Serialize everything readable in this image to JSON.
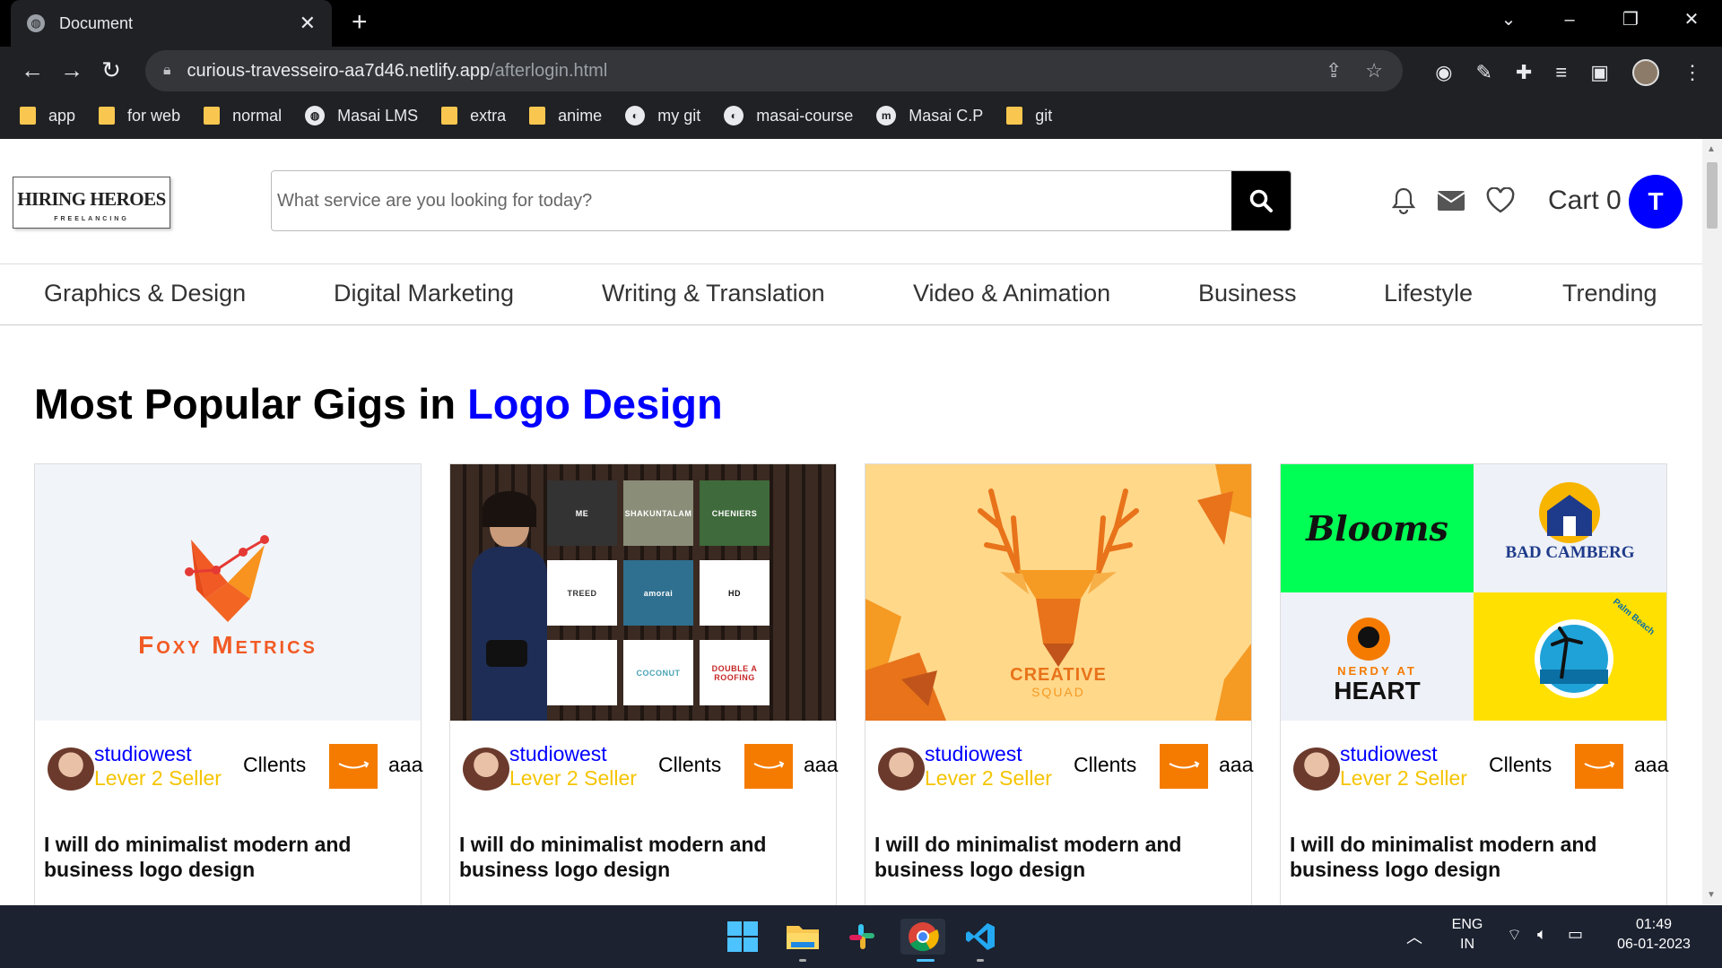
{
  "browser": {
    "tab_title": "Document",
    "url_host": "curious-travesseiro-aa7d46.netlify.app",
    "url_path": "/afterlogin.html",
    "bookmarks": [
      {
        "label": "app",
        "icon": "folder-icon"
      },
      {
        "label": "for web",
        "icon": "folder-icon"
      },
      {
        "label": "normal",
        "icon": "folder-icon"
      },
      {
        "label": "Masai LMS",
        "icon": "globe-icon"
      },
      {
        "label": "extra",
        "icon": "folder-icon"
      },
      {
        "label": "anime",
        "icon": "folder-icon"
      },
      {
        "label": "my git",
        "icon": "github-icon"
      },
      {
        "label": "masai-course",
        "icon": "github-icon"
      },
      {
        "label": "Masai C.P",
        "icon": "masai-icon"
      },
      {
        "label": "git",
        "icon": "folder-icon"
      }
    ]
  },
  "header": {
    "logo_title": "HIRING HEROES",
    "logo_subtitle": "FREELANCING",
    "search_placeholder": "What service are you looking for today?",
    "cart_label": "Cart 0",
    "avatar_letter": "T"
  },
  "categories": [
    "Graphics & Design",
    "Digital Marketing",
    "Writing & Translation",
    "Video & Animation",
    "Business",
    "Lifestyle",
    "Trending"
  ],
  "section": {
    "title_prefix": "Most Popular Gigs in ",
    "title_highlight": "Logo Design"
  },
  "cards": [
    {
      "seller": "studiowest",
      "level": "Lever 2 Seller",
      "clients": "Cllents",
      "client_name": "aaa",
      "title": "I will do minimalist modern and business logo design",
      "image": {
        "brand": "Foxy Metrics"
      }
    },
    {
      "seller": "studiowest",
      "level": "Lever 2 Seller",
      "clients": "Cllents",
      "client_name": "aaa",
      "title": "I will do minimalist modern and business logo design",
      "image": {
        "tiles": [
          "ME",
          "SHAKUNTALAM",
          "CHENIERS",
          "TREED",
          "amorai",
          "HD",
          "",
          "COCONUT",
          "DOUBLE A ROOFING"
        ]
      }
    },
    {
      "seller": "studiowest",
      "level": "Lever 2 Seller",
      "clients": "Cllents",
      "client_name": "aaa",
      "title": "I will do minimalist modern and business logo design",
      "image": {
        "line1": "CREATIVE",
        "line2": "SQUAD"
      }
    },
    {
      "seller": "studiowest",
      "level": "Lever 2 Seller",
      "clients": "Cllents",
      "client_name": "aaa",
      "title": "I will do minimalist modern and business logo design",
      "image": {
        "q1": "Blooms",
        "q2": "BAD CAMBERG",
        "q3a": "NERDY AT",
        "q3b": "HEART",
        "q4": "Palm Beach"
      }
    }
  ],
  "taskbar": {
    "lang1": "ENG",
    "lang2": "IN",
    "time": "01:49",
    "date": "06-01-2023"
  },
  "colors": {
    "accent": "#0000ff",
    "level": "#f5c400",
    "amazon": "#f47b00"
  }
}
